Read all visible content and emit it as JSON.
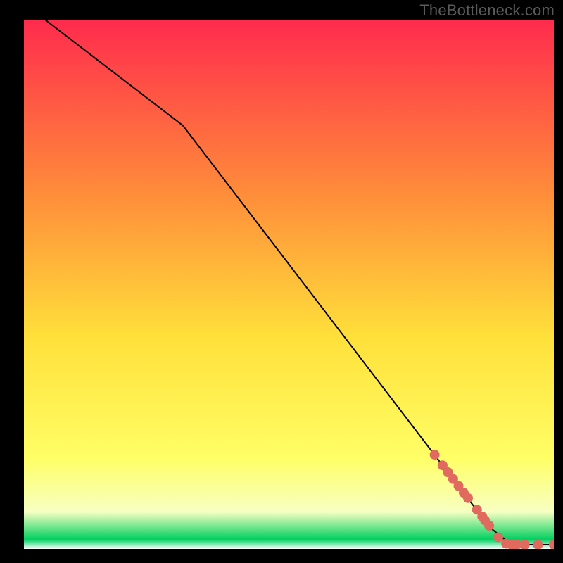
{
  "watermark": "TheBottleneck.com",
  "colors": {
    "frame": "#000000",
    "gradient_top": "#ff2b4d",
    "gradient_mid_upper": "#ff8a3a",
    "gradient_mid": "#ffe03a",
    "gradient_low_yellow": "#ffff66",
    "gradient_pale": "#f7ffc2",
    "gradient_green": "#00d060",
    "gradient_bottom": "#ffffff",
    "line": "#000000",
    "marker": "#e06a5e"
  },
  "chart_data": {
    "type": "line",
    "title": "",
    "xlabel": "",
    "ylabel": "",
    "xlim": [
      0,
      100
    ],
    "ylim": [
      0,
      100
    ],
    "series": [
      {
        "name": "curve",
        "x": [
          4,
          30,
          88,
          92,
          100
        ],
        "y": [
          100,
          80,
          4,
          0.8,
          0.8
        ]
      }
    ],
    "markers": {
      "name": "highlight-points",
      "x": [
        77.5,
        79.0,
        80.0,
        81.0,
        82.0,
        83.0,
        83.8,
        85.5,
        86.5,
        87.0,
        87.8,
        89.5,
        91.0,
        92.0,
        93.0,
        94.5,
        97.0,
        100.0
      ],
      "y": [
        17.8,
        15.8,
        14.5,
        13.2,
        11.9,
        10.6,
        9.6,
        7.4,
        6.1,
        5.4,
        4.4,
        2.2,
        1.0,
        0.8,
        0.8,
        0.8,
        0.8,
        0.8
      ]
    }
  }
}
